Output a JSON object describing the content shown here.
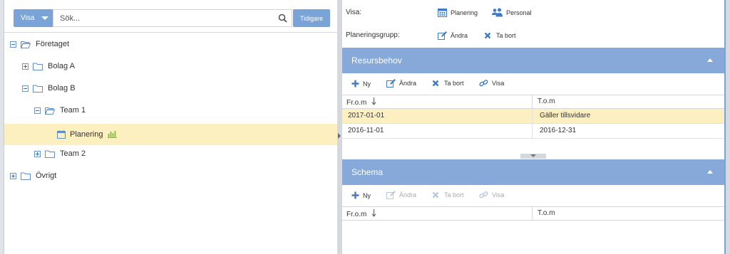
{
  "left": {
    "visa_label": "Visa",
    "search_placeholder": "Sök...",
    "tidigare_label": "Tidigare",
    "tree": {
      "foretaget": "Företaget",
      "bolag_a": "Bolag A",
      "bolag_b": "Bolag B",
      "team_1": "Team 1",
      "planering": "Planering",
      "team_2": "Team 2",
      "ovrigt": "Övrigt"
    }
  },
  "right": {
    "visa_label": "Visa:",
    "visa_planering": "Planering",
    "visa_personal": "Personal",
    "grupp_label": "Planeringsgrupp:",
    "grupp_andra": "Ändra",
    "grupp_tabort": "Ta bort",
    "resursbehov": {
      "title": "Resursbehov",
      "actions": {
        "ny": "Ny",
        "andra": "Ändra",
        "tabort": "Ta bort",
        "visa": "Visa"
      },
      "columns": [
        "Fr.o.m",
        "T.o.m"
      ],
      "rows": [
        [
          "2017-01-01",
          "Gäller tillsvidare"
        ],
        [
          "2016-11-01",
          "2016-12-31"
        ]
      ]
    },
    "schema": {
      "title": "Schema",
      "actions": {
        "ny": "Ny",
        "andra": "Ändra",
        "tabort": "Ta bort",
        "visa": "Visa"
      },
      "columns": [
        "Fr.o.m",
        "T.o.m"
      ]
    }
  },
  "colors": {
    "accent": "#7aa4d8",
    "panel_header": "#86a9d9",
    "selected_row": "#fcefc0",
    "icon_blue": "#3f7cc4",
    "chart_green": "#8cc04b"
  }
}
